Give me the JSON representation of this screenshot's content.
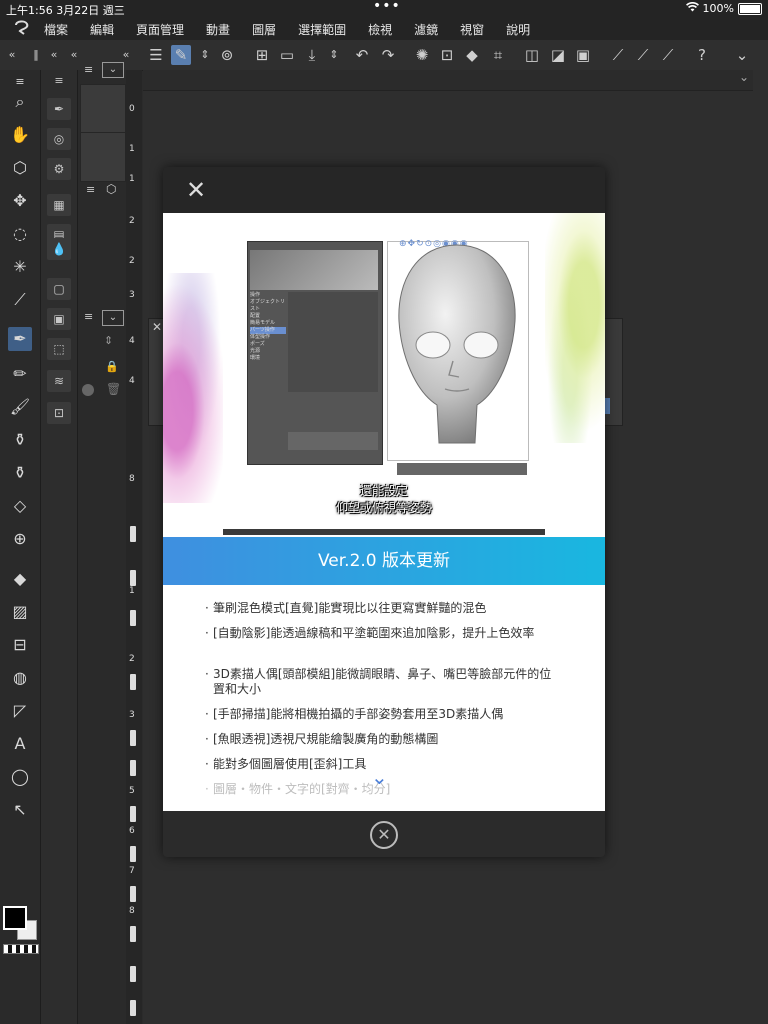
{
  "status_bar": {
    "time": "上午1:56  3月22日 週三",
    "wifi_icon": "wifi-icon",
    "battery": "100%"
  },
  "menu": {
    "items": [
      "檔案",
      "編輯",
      "頁面管理",
      "動畫",
      "圖層",
      "選擇範圍",
      "檢視",
      "濾鏡",
      "視窗",
      "說明"
    ]
  },
  "modal": {
    "hero": {
      "caption_line1": "還能設定",
      "caption_line2": "仰望或俯視等姿勢",
      "tree_items": [
        "操作",
        "オブジェクトリスト",
        "配置",
        "簡易モデル",
        "パーツ操作",
        "体型操作",
        "ポーズ",
        "光源",
        "環境"
      ]
    },
    "banner_title": "Ver.2.0 版本更新",
    "features": [
      "筆刷混色模式[直覺]能實現比以往更寫實鮮豔的混色",
      "[自動陰影]能透過線稿和平塗範圍來追加陰影，提升上色效率",
      "3D素描人偶[頭部模組]能微調眼睛、鼻子、嘴巴等臉部元件的位置和大小",
      "[手部掃描]能將相機拍攝的手部姿勢套用至3D素描人偶",
      "[魚眼透視]透視尺規能繪製廣角的動態構圖",
      "能對多個圖層使用[歪斜]工具",
      "圖層・物件・文字的[對齊・均分]"
    ]
  }
}
